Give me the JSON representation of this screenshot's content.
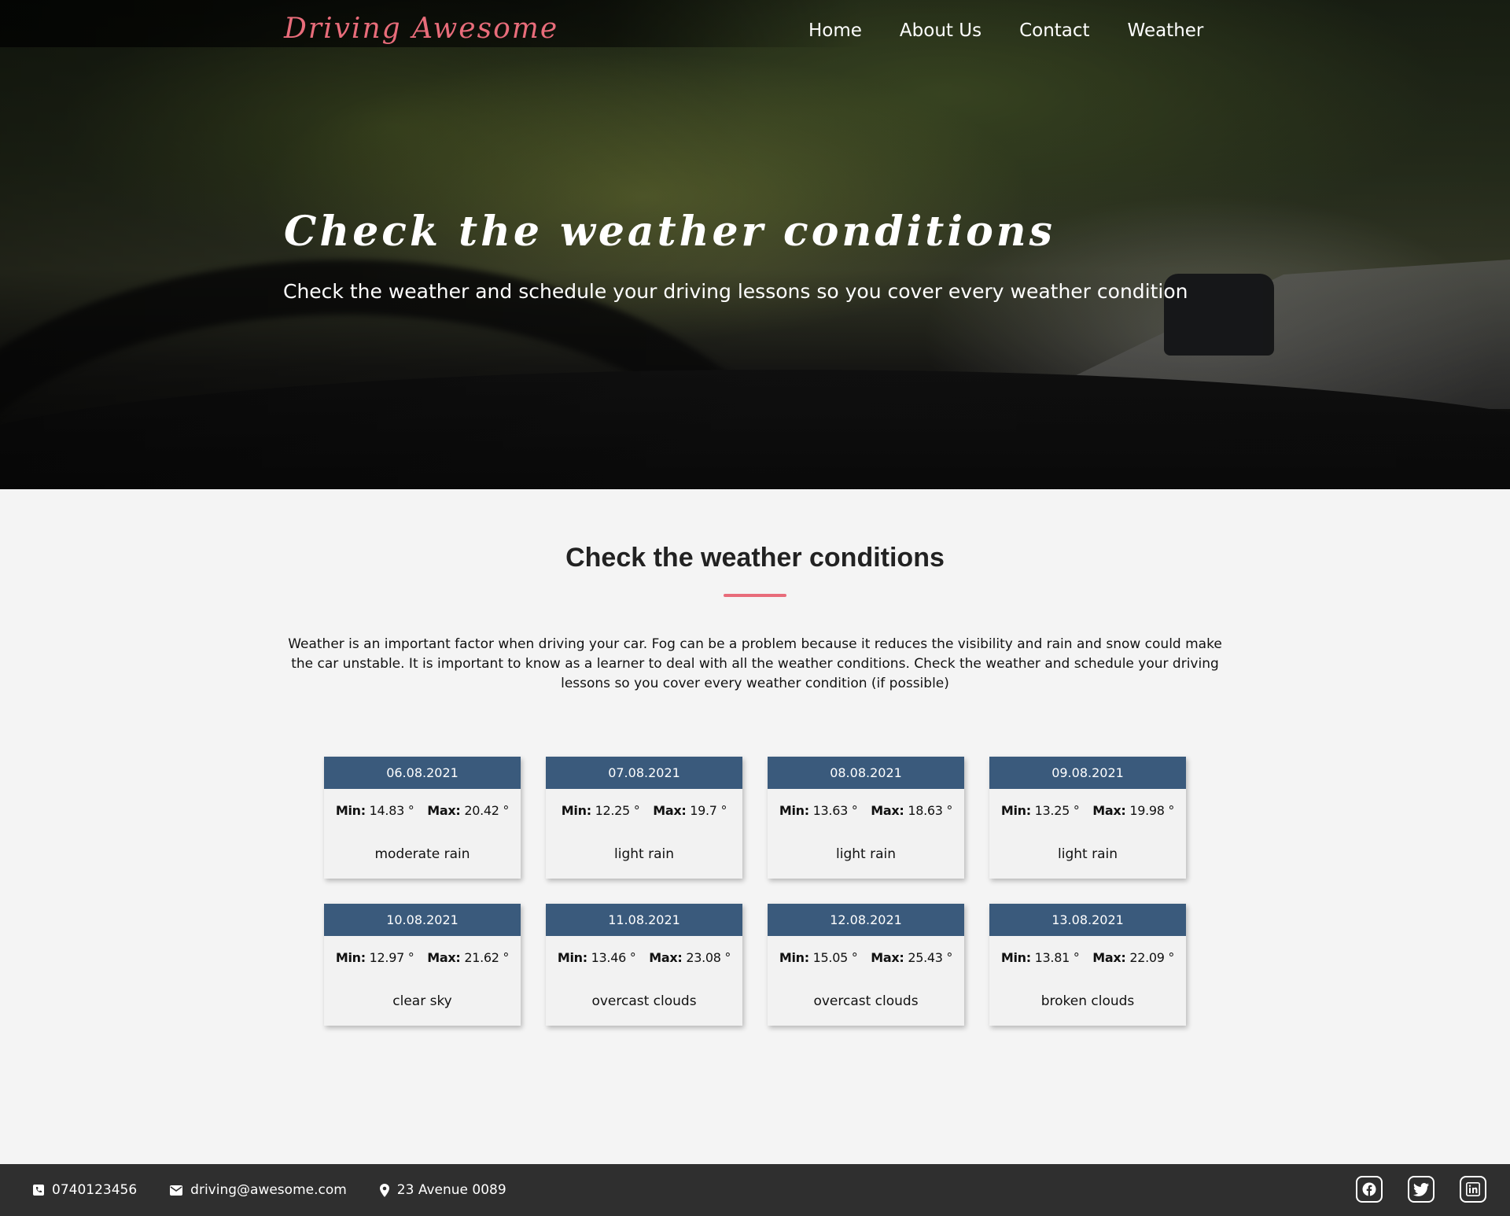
{
  "brand": "Driving Awesome",
  "nav": {
    "items": [
      {
        "label": "Home"
      },
      {
        "label": "About Us"
      },
      {
        "label": "Contact"
      },
      {
        "label": "Weather"
      }
    ]
  },
  "hero": {
    "title": "Check the weather conditions",
    "subtitle": "Check the weather and schedule your driving lessons so you cover every weather condition"
  },
  "section": {
    "title": "Check the weather conditions",
    "intro": "Weather is an important factor when driving your car. Fog can be a problem because it reduces the visibility and rain and snow could make the car unstable. It is important to know as a learner to deal with all the weather conditions. Check the weather and schedule your driving lessons so you cover every weather condition (if possible)"
  },
  "forecast": {
    "min_label": "Min:",
    "max_label": "Max:",
    "degree": "°",
    "days": [
      {
        "date": "06.08.2021",
        "min": "14.83",
        "max": "20.42",
        "desc": "moderate rain"
      },
      {
        "date": "07.08.2021",
        "min": "12.25",
        "max": "19.7",
        "desc": "light rain"
      },
      {
        "date": "08.08.2021",
        "min": "13.63",
        "max": "18.63",
        "desc": "light rain"
      },
      {
        "date": "09.08.2021",
        "min": "13.25",
        "max": "19.98",
        "desc": "light rain"
      },
      {
        "date": "10.08.2021",
        "min": "12.97",
        "max": "21.62",
        "desc": "clear sky"
      },
      {
        "date": "11.08.2021",
        "min": "13.46",
        "max": "23.08",
        "desc": "overcast clouds"
      },
      {
        "date": "12.08.2021",
        "min": "15.05",
        "max": "25.43",
        "desc": "overcast clouds"
      },
      {
        "date": "13.08.2021",
        "min": "13.81",
        "max": "22.09",
        "desc": "broken clouds"
      }
    ]
  },
  "footer": {
    "phone": "0740123456",
    "email": "driving@awesome.com",
    "address": "23 Avenue 0089",
    "social": [
      "facebook-icon",
      "twitter-icon",
      "linkedin-icon"
    ]
  },
  "colors": {
    "brand": "#e86c7a",
    "card_header": "#3a5a7c",
    "footer_bg": "#2f2f2f",
    "page_bg": "#f4f4f4"
  }
}
